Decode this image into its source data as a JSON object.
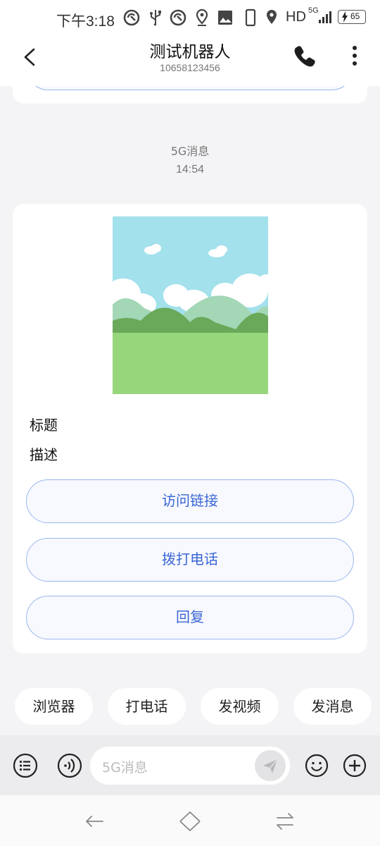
{
  "status_bar": {
    "time": "下午3:18",
    "hd": "HD",
    "network": "5G",
    "battery_level": "65"
  },
  "header": {
    "title": "测试机器人",
    "phone_number": "10658123456",
    "icons": [
      "back-icon",
      "phone-icon",
      "more-vertical-icon"
    ]
  },
  "conversation": {
    "sender_label": "5G消息",
    "timestamp": "14:54",
    "card": {
      "title": "标题",
      "description": "描述",
      "buttons": [
        "访问链接",
        "拨打电话",
        "回复"
      ]
    }
  },
  "quick_replies": [
    "浏览器",
    "打电话",
    "发视频",
    "发消息"
  ],
  "input_bar": {
    "placeholder": "5G消息",
    "icons": [
      "menu-list-icon",
      "voice-icon",
      "send-icon",
      "emoji-icon",
      "add-icon"
    ]
  },
  "colors": {
    "accent": "#3b66d4",
    "button_border": "#9bb6ee",
    "background": "#f4f4f6"
  }
}
